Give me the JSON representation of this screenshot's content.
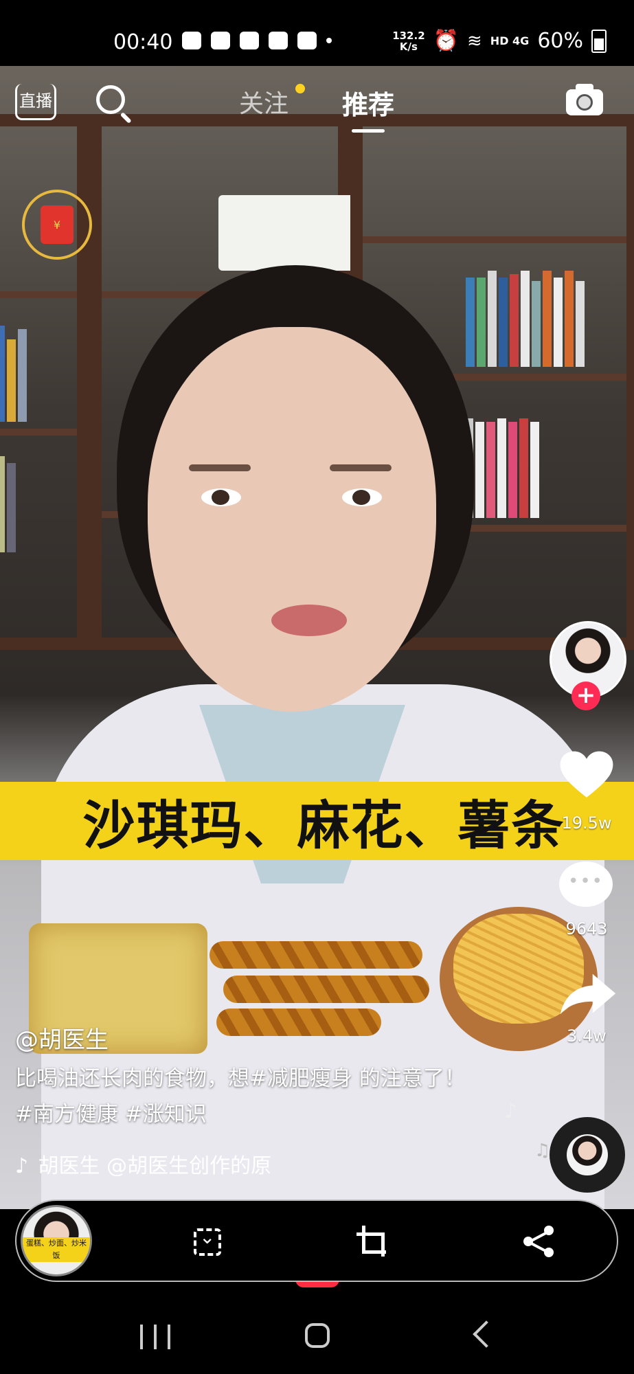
{
  "status_bar": {
    "time": "00:40",
    "net_speed": "132.2",
    "net_unit": "K/s",
    "network": "HD 4G",
    "battery": "60%"
  },
  "top_nav": {
    "live_label": "直播",
    "follow_tab": "关注",
    "recommend_tab": "推荐",
    "active_tab": "推荐"
  },
  "redpacket": {
    "symbol": "¥"
  },
  "video": {
    "banner_text": "沙琪玛、麻花、薯条"
  },
  "side_actions": {
    "likes": "19.5w",
    "comments": "9643",
    "shares": "3.4w",
    "follow_symbol": "+"
  },
  "post": {
    "author": "@胡医生",
    "caption": "比喝油还长肉的食物，想#减肥瘦身 的注意了！#南方健康 #涨知识",
    "music": "胡医生    @胡医生创作的原"
  },
  "floating_bar": {
    "thumb_text": "蛋糕、炒面、炒米饭"
  },
  "colors": {
    "accent_red": "#fe2c55",
    "banner_yellow": "#f4d21a",
    "follow_dot": "#ffd21f"
  },
  "icons": [
    "live-icon",
    "search-icon",
    "camera-icon",
    "redpacket-icon",
    "heart-icon",
    "comment-icon",
    "share-icon",
    "music-note-icon",
    "scan-icon",
    "crop-icon",
    "share-icon"
  ]
}
